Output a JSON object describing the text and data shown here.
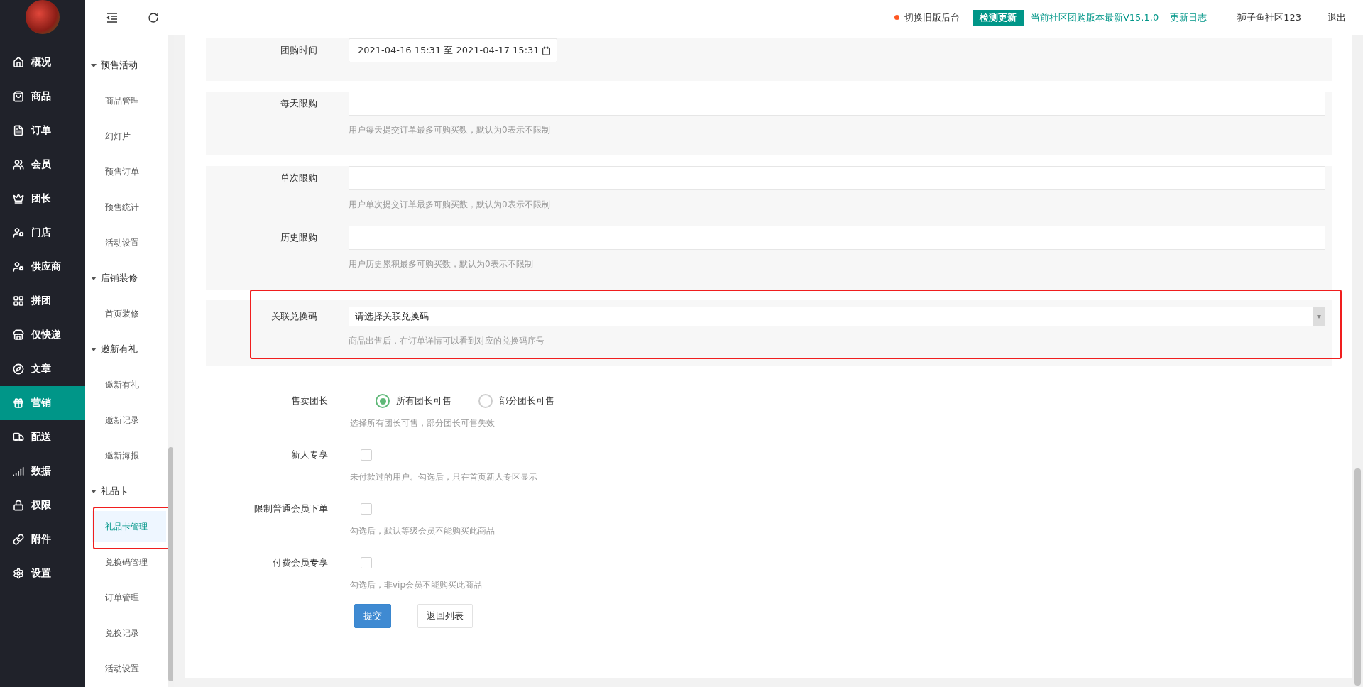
{
  "topbar": {
    "switch_link": "切换旧版后台",
    "check_button": "检测更新",
    "version": "当前社区团购版本最新V15.1.0",
    "changelog": "更新日志",
    "user": "狮子鱼社区123",
    "logout": "退出"
  },
  "sidebar": {
    "items": [
      {
        "label": "概况",
        "selected": false
      },
      {
        "label": "商品",
        "selected": false
      },
      {
        "label": "订单",
        "selected": false
      },
      {
        "label": "会员",
        "selected": false
      },
      {
        "label": "团长",
        "selected": false
      },
      {
        "label": "门店",
        "selected": false
      },
      {
        "label": "供应商",
        "selected": false
      },
      {
        "label": "拼团",
        "selected": false
      },
      {
        "label": "仅快递",
        "selected": false
      },
      {
        "label": "文章",
        "selected": false
      },
      {
        "label": "营销",
        "selected": true
      },
      {
        "label": "配送",
        "selected": false
      },
      {
        "label": "数据",
        "selected": false
      },
      {
        "label": "权限",
        "selected": false
      },
      {
        "label": "附件",
        "selected": false
      },
      {
        "label": "设置",
        "selected": false
      }
    ]
  },
  "subnav": {
    "groups": [
      {
        "title": "预售活动",
        "expanded": true,
        "items": [
          {
            "label": "商品管理",
            "selected": false,
            "highlighted": false
          },
          {
            "label": "幻灯片",
            "selected": false,
            "highlighted": false
          },
          {
            "label": "预售订单",
            "selected": false,
            "highlighted": false
          },
          {
            "label": "预售统计",
            "selected": false,
            "highlighted": false
          },
          {
            "label": "活动设置",
            "selected": false,
            "highlighted": false
          }
        ]
      },
      {
        "title": "店铺装修",
        "expanded": true,
        "items": [
          {
            "label": "首页装修",
            "selected": false,
            "highlighted": false
          }
        ]
      },
      {
        "title": "邀新有礼",
        "expanded": true,
        "items": [
          {
            "label": "邀新有礼",
            "selected": false,
            "highlighted": false
          },
          {
            "label": "邀新记录",
            "selected": false,
            "highlighted": false
          },
          {
            "label": "邀新海报",
            "selected": false,
            "highlighted": false
          }
        ]
      },
      {
        "title": "礼品卡",
        "expanded": true,
        "items": [
          {
            "label": "礼品卡管理",
            "selected": true,
            "highlighted": true
          },
          {
            "label": "兑换码管理",
            "selected": false,
            "highlighted": false
          },
          {
            "label": "订单管理",
            "selected": false,
            "highlighted": false
          },
          {
            "label": "兑换记录",
            "selected": false,
            "highlighted": false
          },
          {
            "label": "活动设置",
            "selected": false,
            "highlighted": false
          }
        ]
      }
    ]
  },
  "form": {
    "sections": [
      {
        "highlighted": false,
        "fields": [
          {
            "kind": "daterange",
            "label": "团购时间",
            "value": "2021-04-16 15:31 至 2021-04-17 15:31"
          }
        ]
      },
      {
        "highlighted": false,
        "fields": [
          {
            "kind": "text",
            "label": "每天限购",
            "hint": "用户每天提交订单最多可购买数，默认为0表示不限制"
          }
        ]
      },
      {
        "highlighted": false,
        "fields": [
          {
            "kind": "text",
            "label": "单次限购",
            "hint": "用户单次提交订单最多可购买数，默认为0表示不限制"
          },
          {
            "kind": "text",
            "label": "历史限购",
            "hint": "用户历史累积最多可购买数，默认为0表示不限制"
          }
        ]
      },
      {
        "highlighted": true,
        "fields": [
          {
            "kind": "select",
            "label": "关联兑换码",
            "value": "请选择关联兑换码",
            "hint": "商品出售后，在订单详情可以看到对应的兑换码序号"
          }
        ]
      }
    ],
    "options": [
      {
        "kind": "radio",
        "label": "售卖团长",
        "choices": [
          {
            "label": "所有团长可售",
            "selected": true
          },
          {
            "label": "部分团长可售",
            "selected": false
          }
        ],
        "hint": "选择所有团长可售，部分团长可售失效"
      },
      {
        "kind": "checkbox",
        "label": "新人专享",
        "checked": false,
        "hint": "未付款过的用户。勾选后，只在首页新人专区显示"
      },
      {
        "kind": "checkbox",
        "label": "限制普通会员下单",
        "checked": false,
        "hint": "勾选后，默认等级会员不能购买此商品"
      },
      {
        "kind": "checkbox",
        "label": "付费会员专享",
        "checked": false,
        "hint": "勾选后，非vip会员不能购买此商品"
      }
    ],
    "buttons": [
      {
        "kind": "primary",
        "label": "提交"
      },
      {
        "kind": "default",
        "label": "返回列表"
      }
    ]
  }
}
